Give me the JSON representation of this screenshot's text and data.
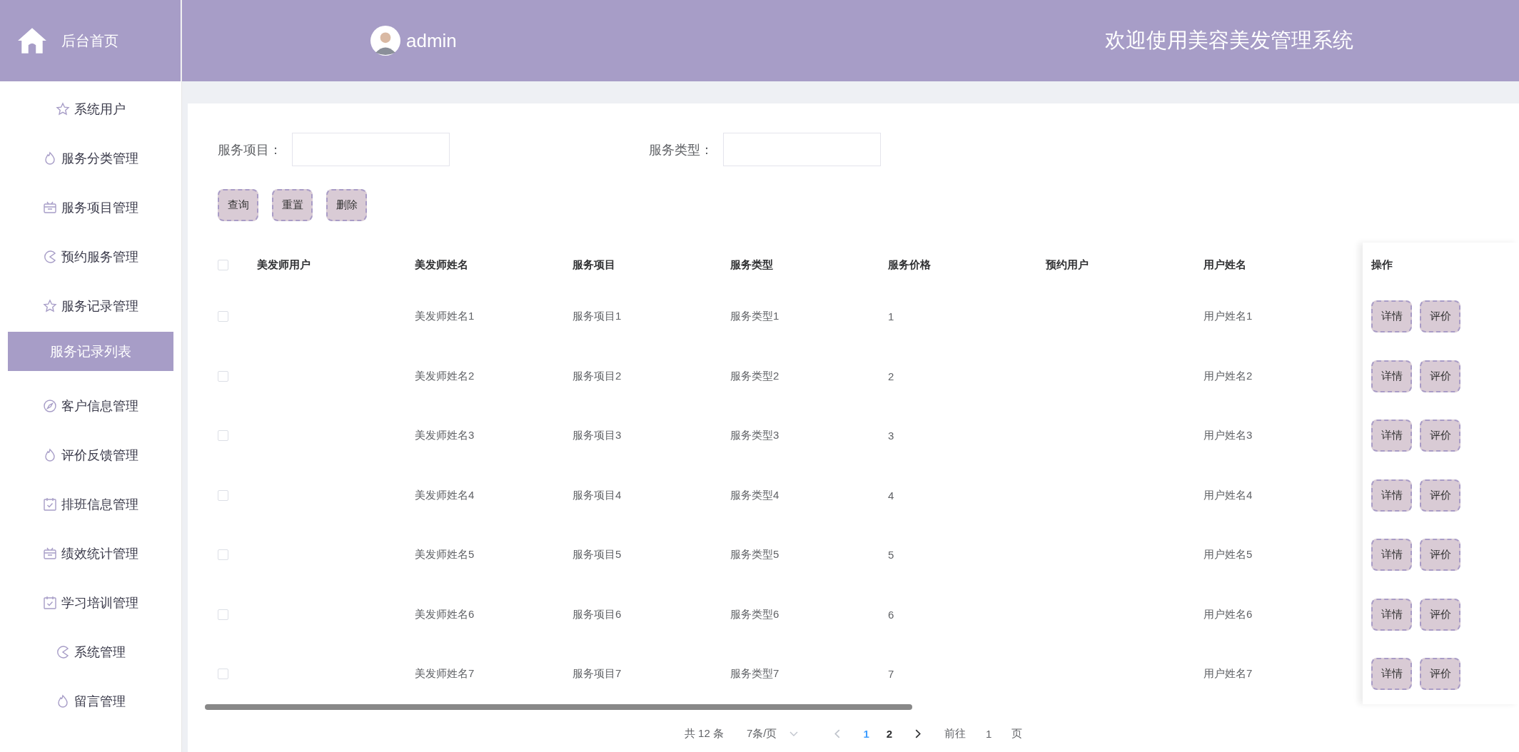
{
  "brand": {
    "label": "后台首页"
  },
  "header": {
    "user": "admin",
    "title": "欢迎使用美容美发管理系统"
  },
  "sidebar": {
    "items": [
      {
        "label": "系统用户",
        "kind": "star",
        "selected": false
      },
      {
        "label": "服务分类管理",
        "kind": "flame",
        "selected": false
      },
      {
        "label": "服务项目管理",
        "kind": "gift",
        "selected": false
      },
      {
        "label": "预约服务管理",
        "kind": "pie",
        "selected": false
      },
      {
        "label": "服务记录管理",
        "kind": "star",
        "selected": false,
        "children": [
          {
            "label": "服务记录列表",
            "selected": true
          }
        ]
      },
      {
        "label": "客户信息管理",
        "kind": "compass",
        "selected": false
      },
      {
        "label": "评价反馈管理",
        "kind": "flame",
        "selected": false
      },
      {
        "label": "排班信息管理",
        "kind": "calendar",
        "selected": false
      },
      {
        "label": "绩效统计管理",
        "kind": "gift",
        "selected": false
      },
      {
        "label": "学习培训管理",
        "kind": "calendar",
        "selected": false
      },
      {
        "label": "系统管理",
        "kind": "pie",
        "selected": false
      },
      {
        "label": "留言管理",
        "kind": "flame",
        "selected": false
      }
    ]
  },
  "filters": [
    {
      "label": "服务项目："
    },
    {
      "label": "服务类型："
    }
  ],
  "buttons": [
    "查询",
    "重置",
    "删除"
  ],
  "table": {
    "select_all": {
      "checked": false
    },
    "columns": [
      "美发师用户",
      "美发师姓名",
      "服务项目",
      "服务类型",
      "服务价格",
      "预约用户",
      "用户姓名"
    ],
    "action_column": "操作",
    "rows": [
      {
        "checked": false,
        "cells": [
          null,
          "美发师姓名1",
          "服务项目1",
          "服务类型1",
          "1",
          null,
          "用户姓名1"
        ],
        "actions": [
          "详情",
          "评价"
        ]
      },
      {
        "checked": false,
        "cells": [
          null,
          "美发师姓名2",
          "服务项目2",
          "服务类型2",
          "2",
          null,
          "用户姓名2"
        ],
        "actions": [
          "详情",
          "评价"
        ]
      },
      {
        "checked": false,
        "cells": [
          null,
          "美发师姓名3",
          "服务项目3",
          "服务类型3",
          "3",
          null,
          "用户姓名3"
        ],
        "actions": [
          "详情",
          "评价"
        ]
      },
      {
        "checked": false,
        "cells": [
          null,
          "美发师姓名4",
          "服务项目4",
          "服务类型4",
          "4",
          null,
          "用户姓名4"
        ],
        "actions": [
          "详情",
          "评价"
        ]
      },
      {
        "checked": false,
        "cells": [
          null,
          "美发师姓名5",
          "服务项目5",
          "服务类型5",
          "5",
          null,
          "用户姓名5"
        ],
        "actions": [
          "详情",
          "评价"
        ]
      },
      {
        "checked": false,
        "cells": [
          null,
          "美发师姓名6",
          "服务项目6",
          "服务类型6",
          "6",
          null,
          "用户姓名6"
        ],
        "actions": [
          "详情",
          "评价"
        ]
      },
      {
        "checked": false,
        "cells": [
          null,
          "美发师姓名7",
          "服务项目7",
          "服务类型7",
          "7",
          null,
          "用户姓名7"
        ],
        "actions": [
          "详情",
          "评价"
        ]
      }
    ]
  },
  "pagination": {
    "total": "共 12 条",
    "page_size": "7条/页",
    "prev_disabled": true,
    "next_disabled": false,
    "pages": [
      {
        "label": "1",
        "selected": true
      },
      {
        "label": "2",
        "selected": false
      }
    ],
    "goto_label": "前往",
    "goto_value": "1",
    "goto_suffix": "页"
  }
}
